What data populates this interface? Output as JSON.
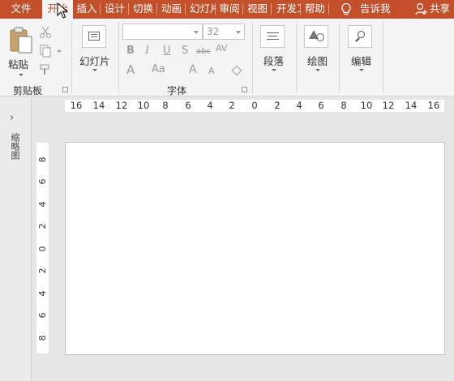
{
  "tabs": [
    {
      "label": "文件",
      "active": false
    },
    {
      "label": "开始",
      "active": true
    },
    {
      "label": "插入",
      "active": false
    },
    {
      "label": "设计",
      "active": false
    },
    {
      "label": "切换",
      "active": false
    },
    {
      "label": "动画",
      "active": false
    },
    {
      "label": "幻灯片放映",
      "active": false
    },
    {
      "label": "审阅",
      "active": false
    },
    {
      "label": "视图",
      "active": false
    },
    {
      "label": "开发工具",
      "active": false
    },
    {
      "label": "帮助",
      "active": false
    }
  ],
  "tell_me": "告诉我",
  "share": "共享",
  "ribbon": {
    "clipboard": {
      "paste": "粘贴",
      "group": "剪贴板"
    },
    "slides": {
      "new_slide": "幻灯片"
    },
    "font": {
      "font_name": "",
      "font_size": "32",
      "group": "字体"
    },
    "paragraph": {
      "label": "段落"
    },
    "drawing": {
      "label": "绘图"
    },
    "editing": {
      "label": "编辑"
    }
  },
  "left_panel": {
    "label": "缩略图"
  },
  "ruler": {
    "horizontal": [
      "16",
      "14",
      "12",
      "10",
      "8",
      "6",
      "4",
      "2",
      "0",
      "2",
      "4",
      "6",
      "8",
      "10",
      "12",
      "14",
      "16"
    ],
    "vertical": [
      "8",
      "6",
      "4",
      "2",
      "0",
      "2",
      "4",
      "6",
      "8"
    ]
  },
  "colors": {
    "accent": "#c3502b",
    "ribbon_bg": "#f4f4f4",
    "workspace_bg": "#e6e6e6"
  }
}
